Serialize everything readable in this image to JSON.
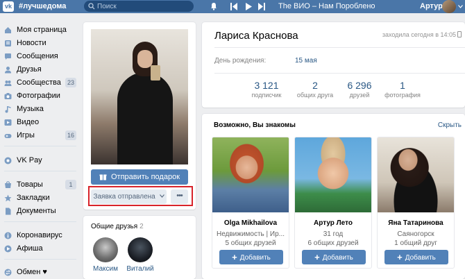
{
  "header": {
    "hashtag": "#лучшедома",
    "search_placeholder": "Поиск",
    "track": "The ВИО – Нам Поробленo",
    "user_name": "Артур"
  },
  "menu": {
    "items": [
      {
        "label": "Моя страница",
        "icon": "home-icon"
      },
      {
        "label": "Новости",
        "icon": "news-icon"
      },
      {
        "label": "Сообщения",
        "icon": "messages-icon"
      },
      {
        "label": "Друзья",
        "icon": "friends-icon"
      },
      {
        "label": "Сообщества",
        "icon": "groups-icon",
        "count": "23"
      },
      {
        "label": "Фотографии",
        "icon": "camera-icon"
      },
      {
        "label": "Музыка",
        "icon": "music-icon"
      },
      {
        "label": "Видео",
        "icon": "video-icon"
      },
      {
        "label": "Игры",
        "icon": "games-icon",
        "count": "16"
      },
      {
        "label": "VK Pay",
        "icon": "vkpay-icon"
      },
      {
        "label": "Товары",
        "icon": "goods-icon",
        "count": "1"
      },
      {
        "label": "Закладки",
        "icon": "star-icon"
      },
      {
        "label": "Документы",
        "icon": "docs-icon"
      },
      {
        "label": "Коронавирус",
        "icon": "info-icon"
      },
      {
        "label": "Афиша",
        "icon": "afisha-icon"
      },
      {
        "label": "Обмен ♥",
        "icon": "exchange-icon"
      }
    ]
  },
  "profile": {
    "gift_button": "Отправить подарок",
    "request_button": "Заявка отправлена",
    "more_button": "•••",
    "name": "Лариса Краснова",
    "last_seen": "заходила сегодня в 14:05",
    "birthday_label": "День рождения:",
    "birthday_value": "15 мая",
    "stats": [
      {
        "value": "3 121",
        "label": "подписчик"
      },
      {
        "value": "2",
        "label": "общих друга"
      },
      {
        "value": "6 296",
        "label": "друзей"
      },
      {
        "value": "1",
        "label": "фотография"
      }
    ]
  },
  "common_friends": {
    "title": "Общие друзья",
    "count": "2",
    "people": [
      {
        "name": "Максим"
      },
      {
        "name": "Виталий"
      }
    ]
  },
  "suggestions": {
    "title": "Возможно, Вы знакомы",
    "hide_label": "Скрыть",
    "add_label": "Добавить",
    "people": [
      {
        "name": "Olga Mikhailova",
        "line1": "Недвижимость | Ир...",
        "line2": "5 общих друзей"
      },
      {
        "name": "Артур Лето",
        "line1": "31 год",
        "line2": "6 общих друзей"
      },
      {
        "name": "Яна Татаринова",
        "line1": "Саяногорск",
        "line2": "1 общий друг"
      }
    ]
  },
  "colors": {
    "header": "#4a76a8",
    "accent": "#5181b8",
    "link": "#2a5885",
    "highlight": "#d8232a"
  }
}
